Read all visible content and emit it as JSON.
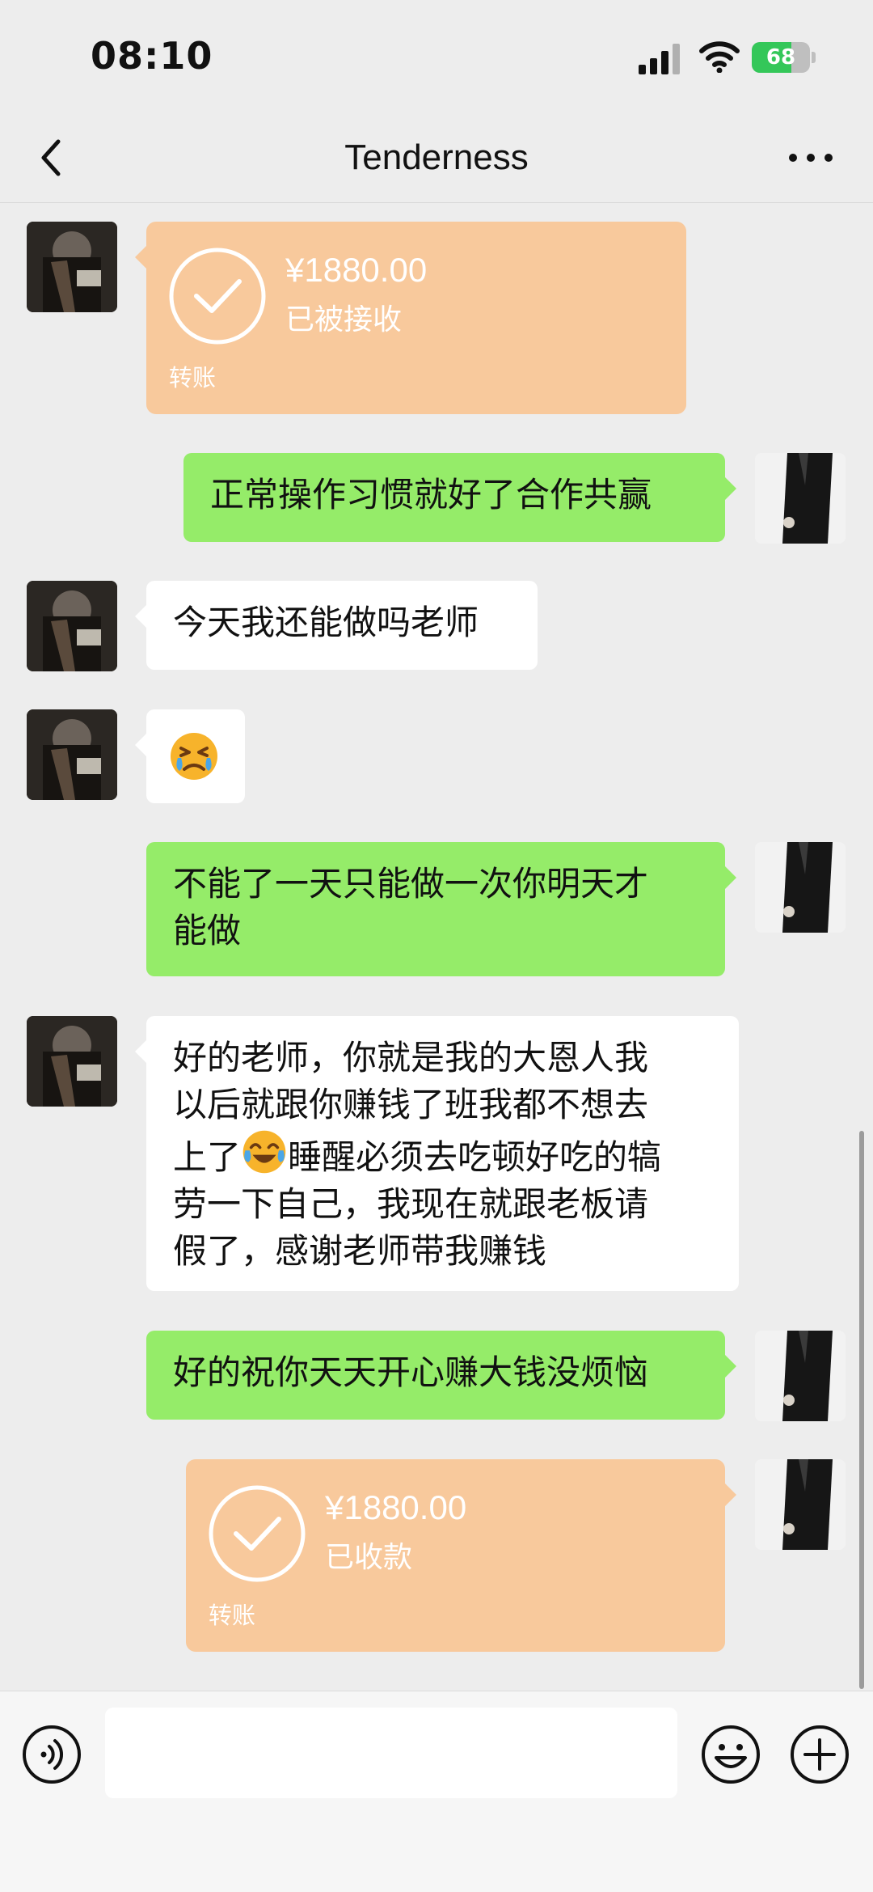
{
  "status_bar": {
    "time": "08:10",
    "battery": "68",
    "battery_level": 0.68
  },
  "header": {
    "title": "Tenderness"
  },
  "messages": {
    "m1": {
      "amount": "¥1880.00",
      "status": "已被接收",
      "label": "转账"
    },
    "m2": {
      "text": "正常操作习惯就好了合作共赢"
    },
    "m3": {
      "text": "今天我还能做吗老师"
    },
    "m4": {
      "emoji": "sad-face-emoji"
    },
    "m5": {
      "text": "不能了一天只能做一次你明天才\n能做"
    },
    "m6": {
      "line1": "好的老师，你就是我的大恩人我",
      "line2": "以后就跟你赚钱了班我都不想去",
      "line3a": "上了",
      "line3b": "睡醒必须去吃顿好吃的犒",
      "line4": "劳一下自己，我现在就跟老板请",
      "line5": "假了，感谢老师带我赚钱"
    },
    "m7": {
      "text": "好的祝你天天开心赚大钱没烦恼"
    },
    "m8": {
      "amount": "¥1880.00",
      "status": "已收款",
      "label": "转账"
    }
  },
  "colors": {
    "background": "#ededed",
    "sent_bubble": "#95ec69",
    "received_bubble": "#ffffff",
    "transfer_bubble": "#f8c99c",
    "battery_green": "#34c759"
  },
  "icons": {
    "back": "chevron-left-icon",
    "more": "more-dots-icon",
    "voice": "voice-icon",
    "emoji": "emoji-icon",
    "plus": "plus-icon",
    "transfer": "check-circle-icon"
  }
}
